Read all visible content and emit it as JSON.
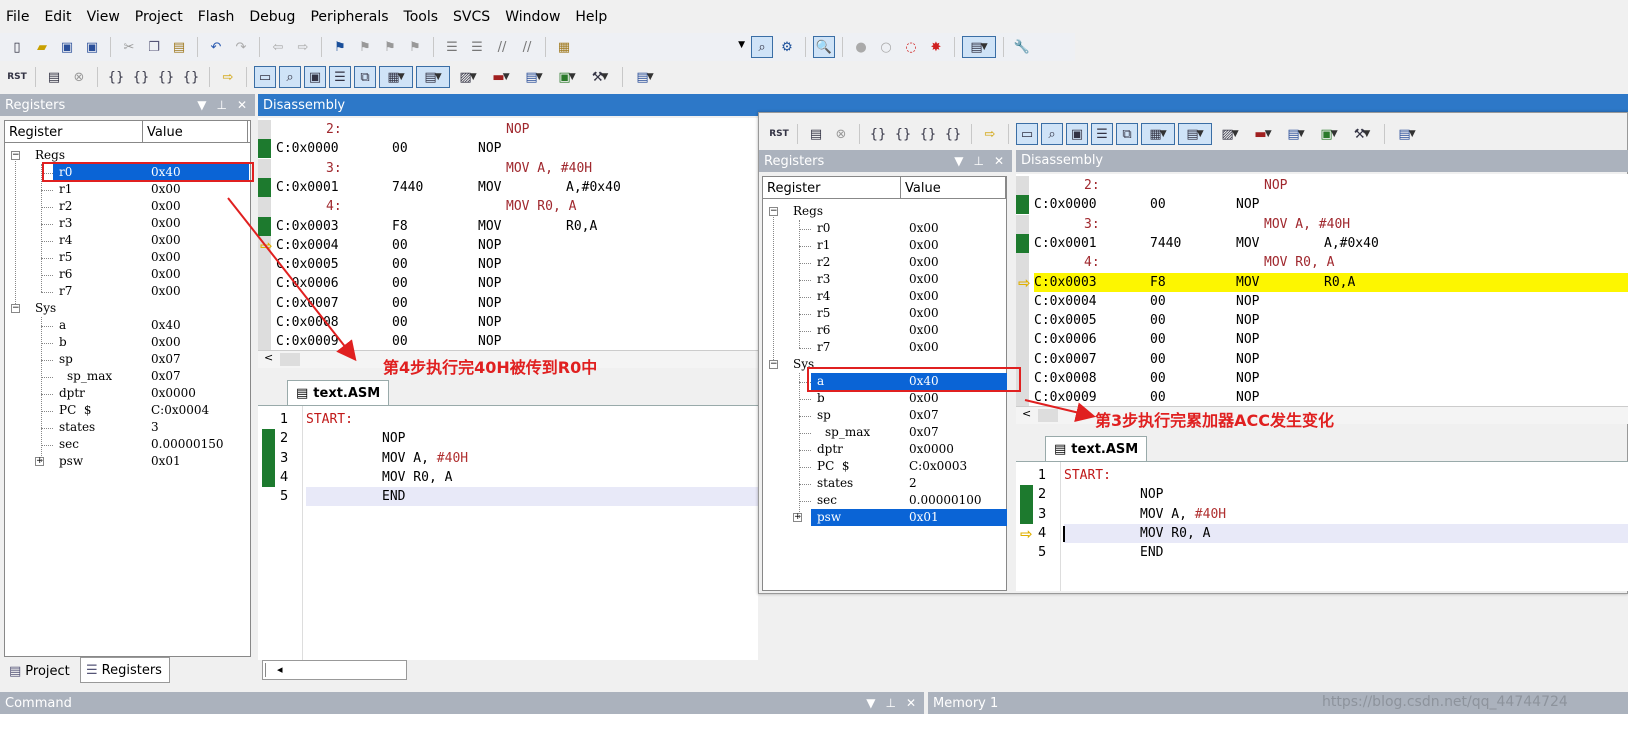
{
  "menu": [
    "File",
    "Edit",
    "View",
    "Project",
    "Flash",
    "Debug",
    "Peripherals",
    "Tools",
    "SVCS",
    "Window",
    "Help"
  ],
  "registers_title": "Registers",
  "disasm_title": "Disassembly",
  "col_register": "Register",
  "col_value": "Value",
  "left_regs": {
    "group_regs": "Regs",
    "group_sys": "Sys",
    "regs": [
      [
        "r0",
        "0x40"
      ],
      [
        "r1",
        "0x00"
      ],
      [
        "r2",
        "0x00"
      ],
      [
        "r3",
        "0x00"
      ],
      [
        "r4",
        "0x00"
      ],
      [
        "r5",
        "0x00"
      ],
      [
        "r6",
        "0x00"
      ],
      [
        "r7",
        "0x00"
      ]
    ],
    "sys": [
      [
        "a",
        "0x40"
      ],
      [
        "b",
        "0x00"
      ],
      [
        "sp",
        "0x07"
      ],
      [
        "sp_max",
        "0x07"
      ],
      [
        "dptr",
        "0x0000"
      ],
      [
        "PC  $",
        "C:0x0004"
      ],
      [
        "states",
        "3"
      ],
      [
        "sec",
        "0.00000150"
      ],
      [
        "psw",
        "0x01"
      ]
    ]
  },
  "right_regs": {
    "group_regs": "Regs",
    "group_sys": "Sys",
    "regs": [
      [
        "r0",
        "0x00"
      ],
      [
        "r1",
        "0x00"
      ],
      [
        "r2",
        "0x00"
      ],
      [
        "r3",
        "0x00"
      ],
      [
        "r4",
        "0x00"
      ],
      [
        "r5",
        "0x00"
      ],
      [
        "r6",
        "0x00"
      ],
      [
        "r7",
        "0x00"
      ]
    ],
    "sys": [
      [
        "a",
        "0x40"
      ],
      [
        "b",
        "0x00"
      ],
      [
        "sp",
        "0x07"
      ],
      [
        "sp_max",
        "0x07"
      ],
      [
        "dptr",
        "0x0000"
      ],
      [
        "PC  $",
        "C:0x0003"
      ],
      [
        "states",
        "2"
      ],
      [
        "sec",
        "0.00000100"
      ],
      [
        "psw",
        "0x01"
      ]
    ]
  },
  "left_disasm": [
    {
      "src": "2:",
      "code": "NOP"
    },
    {
      "addr": "C:0x0000",
      "op": "00",
      "mn": "NOP",
      "arg": ""
    },
    {
      "src": "3:",
      "code": "MOV A, #40H"
    },
    {
      "addr": "C:0x0001",
      "op": "7440",
      "mn": "MOV",
      "arg": "A,#0x40"
    },
    {
      "src": "4:",
      "code": "MOV R0, A"
    },
    {
      "addr": "C:0x0003",
      "op": "F8",
      "mn": "MOV",
      "arg": "R0,A"
    },
    {
      "addr": "C:0x0004",
      "op": "00",
      "mn": "NOP",
      "arg": ""
    },
    {
      "addr": "C:0x0005",
      "op": "00",
      "mn": "NOP",
      "arg": ""
    },
    {
      "addr": "C:0x0006",
      "op": "00",
      "mn": "NOP",
      "arg": ""
    },
    {
      "addr": "C:0x0007",
      "op": "00",
      "mn": "NOP",
      "arg": ""
    },
    {
      "addr": "C:0x0008",
      "op": "00",
      "mn": "NOP",
      "arg": ""
    },
    {
      "addr": "C:0x0009",
      "op": "00",
      "mn": "NOP",
      "arg": ""
    }
  ],
  "right_disasm": [
    {
      "src": "2:",
      "code": "NOP"
    },
    {
      "addr": "C:0x0000",
      "op": "00",
      "mn": "NOP",
      "arg": ""
    },
    {
      "src": "3:",
      "code": "MOV A, #40H"
    },
    {
      "addr": "C:0x0001",
      "op": "7440",
      "mn": "MOV",
      "arg": "A,#0x40"
    },
    {
      "src": "4:",
      "code": "MOV R0, A"
    },
    {
      "addr": "C:0x0003",
      "op": "F8",
      "mn": "MOV",
      "arg": "R0,A"
    },
    {
      "addr": "C:0x0004",
      "op": "00",
      "mn": "NOP",
      "arg": ""
    },
    {
      "addr": "C:0x0005",
      "op": "00",
      "mn": "NOP",
      "arg": ""
    },
    {
      "addr": "C:0x0006",
      "op": "00",
      "mn": "NOP",
      "arg": ""
    },
    {
      "addr": "C:0x0007",
      "op": "00",
      "mn": "NOP",
      "arg": ""
    },
    {
      "addr": "C:0x0008",
      "op": "00",
      "mn": "NOP",
      "arg": ""
    },
    {
      "addr": "C:0x0009",
      "op": "00",
      "mn": "NOP",
      "arg": ""
    }
  ],
  "src_tab": "text.ASM",
  "source": [
    {
      "n": "1",
      "label": "START:",
      "ins": "",
      "arg": "",
      "imm": ""
    },
    {
      "n": "2",
      "label": "",
      "ins": "NOP",
      "arg": "",
      "imm": ""
    },
    {
      "n": "3",
      "label": "",
      "ins": "MOV A, ",
      "arg": "",
      "imm": "#40H"
    },
    {
      "n": "4",
      "label": "",
      "ins": "MOV R0, A",
      "arg": "",
      "imm": ""
    },
    {
      "n": "5",
      "label": "",
      "ins": "END",
      "arg": "",
      "imm": ""
    }
  ],
  "left_note": "第4步执行完40H被传到R0中",
  "right_note": "第3步执行完累加器ACC发生变化",
  "bottom_tabs": {
    "project": "Project",
    "registers": "Registers"
  },
  "command_title": "Command",
  "memory_title": "Memory 1",
  "watermark": "https://blog.csdn.net/qq_44744724",
  "toolbar_rst": "RST"
}
